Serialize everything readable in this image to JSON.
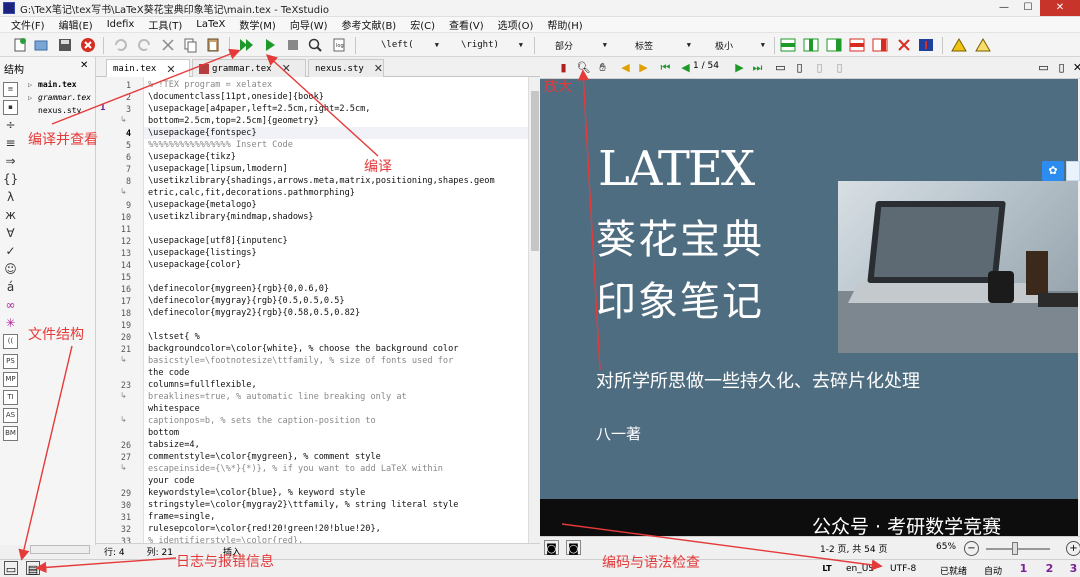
{
  "window": {
    "title": "G:\\TeX笔记\\tex写书\\LaTeX葵花宝典印象笔记\\main.tex - TeXstudio",
    "controls": [
      "—",
      "☐",
      "✕"
    ]
  },
  "menubar": {
    "items": [
      "文件(F)",
      "编辑(E)",
      "Idefix",
      "工具(T)",
      "LaTeX",
      "数学(M)",
      "向导(W)",
      "参考文献(B)",
      "宏(C)",
      "查看(V)",
      "选项(O)",
      "帮助(H)"
    ]
  },
  "toolbar": {
    "left_combo": "\\left(",
    "right_combo": "\\right)",
    "combo_part": "部分",
    "combo_label": "标签",
    "combo_size": "极小"
  },
  "structure": {
    "title": "结构",
    "close": "✕",
    "files": [
      {
        "name": "main.tex",
        "style": "bold"
      },
      {
        "name": "grammar.tex",
        "style": "italic"
      },
      {
        "name": "nexus.sty",
        "style": "normal"
      }
    ]
  },
  "tabs": [
    {
      "label": "main.tex",
      "close": "✕"
    },
    {
      "label": "grammar.tex",
      "close": "✕"
    },
    {
      "label": "nexus.sty",
      "close": "✕"
    }
  ],
  "editor": {
    "lines": [
      {
        "n": "1",
        "text": "% !TEX program = xelatex"
      },
      {
        "n": "2",
        "text": "\\documentclass[11pt,oneside]{book}"
      },
      {
        "n": "3",
        "text": "\\usepackage[a4paper,left=2.5cm,right=2.5cm,"
      },
      {
        "n": "",
        "text": "bottom=2.5cm,top=2.5cm]{geometry}"
      },
      {
        "n": "4",
        "text": "\\usepackage{fontspec}"
      },
      {
        "n": "5",
        "text": "%%%%%%%%%%%%%%%% Insert Code"
      },
      {
        "n": "6",
        "text": "\\usepackage{tikz}"
      },
      {
        "n": "7",
        "text": "\\usepackage[lipsum,lmodern]"
      },
      {
        "n": "8",
        "text": "\\usetikzlibrary{shadings,arrows.meta,matrix,positioning,shapes.geom"
      },
      {
        "n": "",
        "text": "etric,calc,fit,decorations.pathmorphing}"
      },
      {
        "n": "9",
        "text": "\\usepackage{metalogo}"
      },
      {
        "n": "10",
        "text": "\\usetikzlibrary{mindmap,shadows}"
      },
      {
        "n": "11",
        "text": ""
      },
      {
        "n": "12",
        "text": "\\usepackage[utf8]{inputenc}"
      },
      {
        "n": "13",
        "text": "\\usepackage{listings}"
      },
      {
        "n": "14",
        "text": "\\usepackage{color}"
      },
      {
        "n": "15",
        "text": ""
      },
      {
        "n": "16",
        "text": "\\definecolor{mygreen}{rgb}{0,0.6,0}"
      },
      {
        "n": "17",
        "text": "\\definecolor{mygray}{rgb}{0.5,0.5,0.5}"
      },
      {
        "n": "18",
        "text": "\\definecolor{mygray2}{rgb}{0.58,0.5,0.82}"
      },
      {
        "n": "19",
        "text": ""
      },
      {
        "n": "20",
        "text": "\\lstset{ %"
      },
      {
        "n": "21",
        "text": "backgroundcolor=\\color{white},   % choose the background color"
      },
      {
        "n": "22",
        "text": "basicstyle=\\footnotesize\\ttfamily,     % size of fonts used for"
      },
      {
        "n": "",
        "text": "the code"
      },
      {
        "n": "23",
        "text": "columns=fullflexible,"
      },
      {
        "n": "24",
        "text": "breaklines=true,                 % automatic line breaking only at"
      },
      {
        "n": "",
        "text": "whitespace"
      },
      {
        "n": "25",
        "text": "captionpos=b,                    % sets the caption-position to"
      },
      {
        "n": "",
        "text": "bottom"
      },
      {
        "n": "26",
        "text": "tabsize=4,"
      },
      {
        "n": "27",
        "text": "commentstyle=\\color{mygreen},    % comment style"
      },
      {
        "n": "28",
        "text": "escapeinside={\\%*}{*)},          % if you want to add LaTeX within"
      },
      {
        "n": "",
        "text": "your code"
      },
      {
        "n": "29",
        "text": "keywordstyle=\\color{blue},       % keyword style"
      },
      {
        "n": "30",
        "text": "stringstyle=\\color{mygray2}\\ttfamily,     % string literal style"
      },
      {
        "n": "31",
        "text": "frame=single,"
      },
      {
        "n": "32",
        "text": "rulesepcolor=\\color{red!20!green!20!blue!20},"
      },
      {
        "n": "33",
        "text": "% identifierstyle=\\color{red},"
      }
    ]
  },
  "editor_status": {
    "row_label": "行: 4",
    "col_label": "列: 21",
    "mode": "插入"
  },
  "preview_toolbar": {
    "page": "1 / 54"
  },
  "slide": {
    "latex_logo": "LATEX",
    "title_line1": "葵花宝典",
    "title_line2": "印象笔记",
    "subtitle": "对所学所思做一些持久化、去碎片化处理",
    "author": "八一著",
    "watermark": "公众号 · 考研数学竞赛"
  },
  "preview_status": {
    "pages": "1-2 页, 共 54 页",
    "zoom": "65%"
  },
  "bottombar": {
    "lang": "en_US",
    "encoding": "UTF-8",
    "ready": "已就绪",
    "auto": "自动"
  },
  "annotations": {
    "compile_view": "编译并查看",
    "compile": "编译",
    "zoom_in": "放大",
    "file_structure": "文件结构",
    "log": "日志与报错信息",
    "encoding_check": "编码与语法检查"
  },
  "colors": {
    "annotation": "#e53a3a",
    "slide_bg": "#4f6d80",
    "compile_green": "#1e9a2a"
  }
}
